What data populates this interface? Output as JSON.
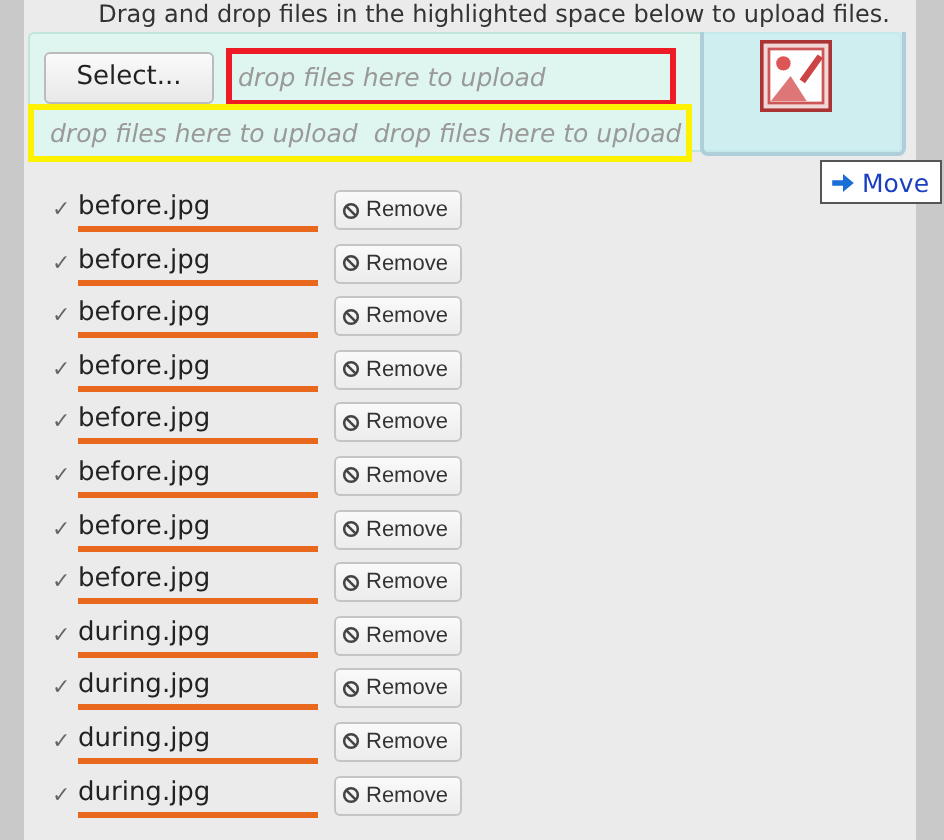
{
  "instructions": "Drag and drop files in the highlighted space below to upload files.",
  "upload": {
    "select_button": "Select...",
    "drop_zone": "drop files here to upload",
    "drop_hints": [
      "drop files here to upload",
      "drop files here to upload"
    ]
  },
  "drag_tooltip": {
    "label": "Move"
  },
  "files": [
    {
      "check": "✓",
      "name": "before.jpg",
      "level": 1,
      "remove": "Remove"
    },
    {
      "check": "✓",
      "name": "before.jpg",
      "level": 1,
      "remove": "Remove"
    },
    {
      "check": "✓",
      "name": "before.jpg",
      "level": 1,
      "remove": "Remove"
    },
    {
      "check": "✓",
      "name": "before.jpg",
      "level": 1,
      "remove": "Remove"
    },
    {
      "check": "✓",
      "name": "before.jpg",
      "level": 1,
      "remove": "Remove"
    },
    {
      "check": "✓",
      "name": "before.jpg",
      "level": 1,
      "remove": "Remove"
    },
    {
      "check": "✓",
      "name": "before.jpg",
      "level": 1,
      "remove": "Remove"
    },
    {
      "check": "✓",
      "name": "before.jpg",
      "level": 1,
      "remove": "Remove"
    },
    {
      "check": "✓",
      "name": "during.jpg",
      "level": 1,
      "remove": "Remove"
    },
    {
      "check": "✓",
      "name": "during.jpg",
      "level": 1,
      "remove": "Remove"
    },
    {
      "check": "✓",
      "name": "during.jpg",
      "level": 1,
      "remove": "Remove"
    },
    {
      "check": "✓",
      "name": "during.jpg",
      "level": 1,
      "remove": "Remove"
    }
  ]
}
